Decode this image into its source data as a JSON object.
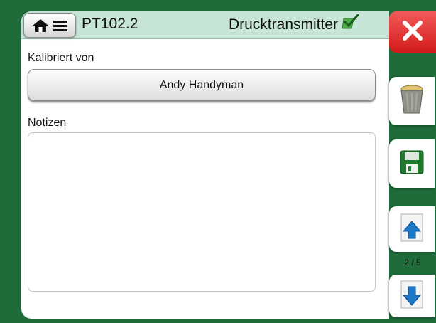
{
  "header": {
    "tag": "PT102.2",
    "device_type": "Drucktransmitter",
    "home_icon": "home-icon",
    "menu_icon": "hamburger-menu-icon",
    "status_icon": "checkmark-icon"
  },
  "form": {
    "calibrated_by_label": "Kalibriert von",
    "calibrated_by_value": "Andy Handyman",
    "notes_label": "Notizen",
    "notes_value": ""
  },
  "sidebar": {
    "close_icon": "close-x-icon",
    "delete_icon": "trash-can-icon",
    "save_icon": "floppy-disk-icon",
    "page_up_icon": "page-up-arrow-icon",
    "page_down_icon": "page-down-arrow-icon",
    "page_indicator": "2 / 5"
  },
  "colors": {
    "frame": "#1f6b3a",
    "header": "#c7e5d6",
    "close": "#e03232",
    "arrow": "#1e78c8"
  }
}
